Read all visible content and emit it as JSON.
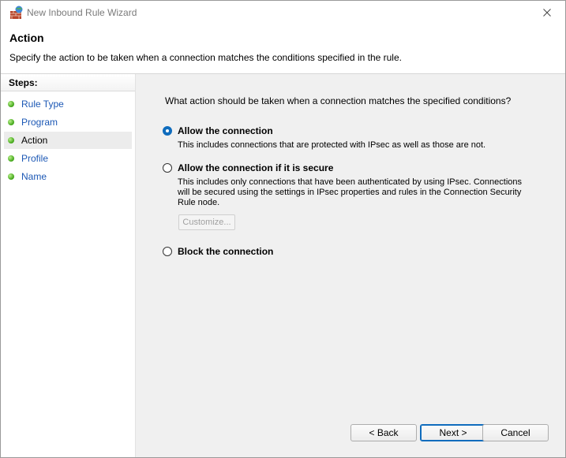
{
  "window": {
    "title": "New Inbound Rule Wizard"
  },
  "header": {
    "title": "Action",
    "subtitle": "Specify the action to be taken when a connection matches the conditions specified in the rule."
  },
  "steps": {
    "heading": "Steps:",
    "items": [
      {
        "label": "Rule Type",
        "state": "completed"
      },
      {
        "label": "Program",
        "state": "completed"
      },
      {
        "label": "Action",
        "state": "current"
      },
      {
        "label": "Profile",
        "state": "pending"
      },
      {
        "label": "Name",
        "state": "pending"
      }
    ]
  },
  "main": {
    "question": "What action should be taken when a connection matches the specified conditions?",
    "options": [
      {
        "label": "Allow the connection",
        "desc": "This includes connections that are protected with IPsec as well as those are not.",
        "checked": true
      },
      {
        "label": "Allow the connection if it is secure",
        "desc": "This includes only connections that have been authenticated by using IPsec.  Connections will be secured using the settings in IPsec properties and rules in the Connection Security Rule node.",
        "checked": false
      },
      {
        "label": "Block the connection",
        "desc": "",
        "checked": false
      }
    ],
    "customize_label": "Customize..."
  },
  "footer": {
    "back_label": "< Back",
    "next_label": "Next >",
    "cancel_label": "Cancel"
  },
  "colors": {
    "accent": "#0f6cbd",
    "link": "#1c58b5",
    "step_dot": "#3ea316"
  }
}
